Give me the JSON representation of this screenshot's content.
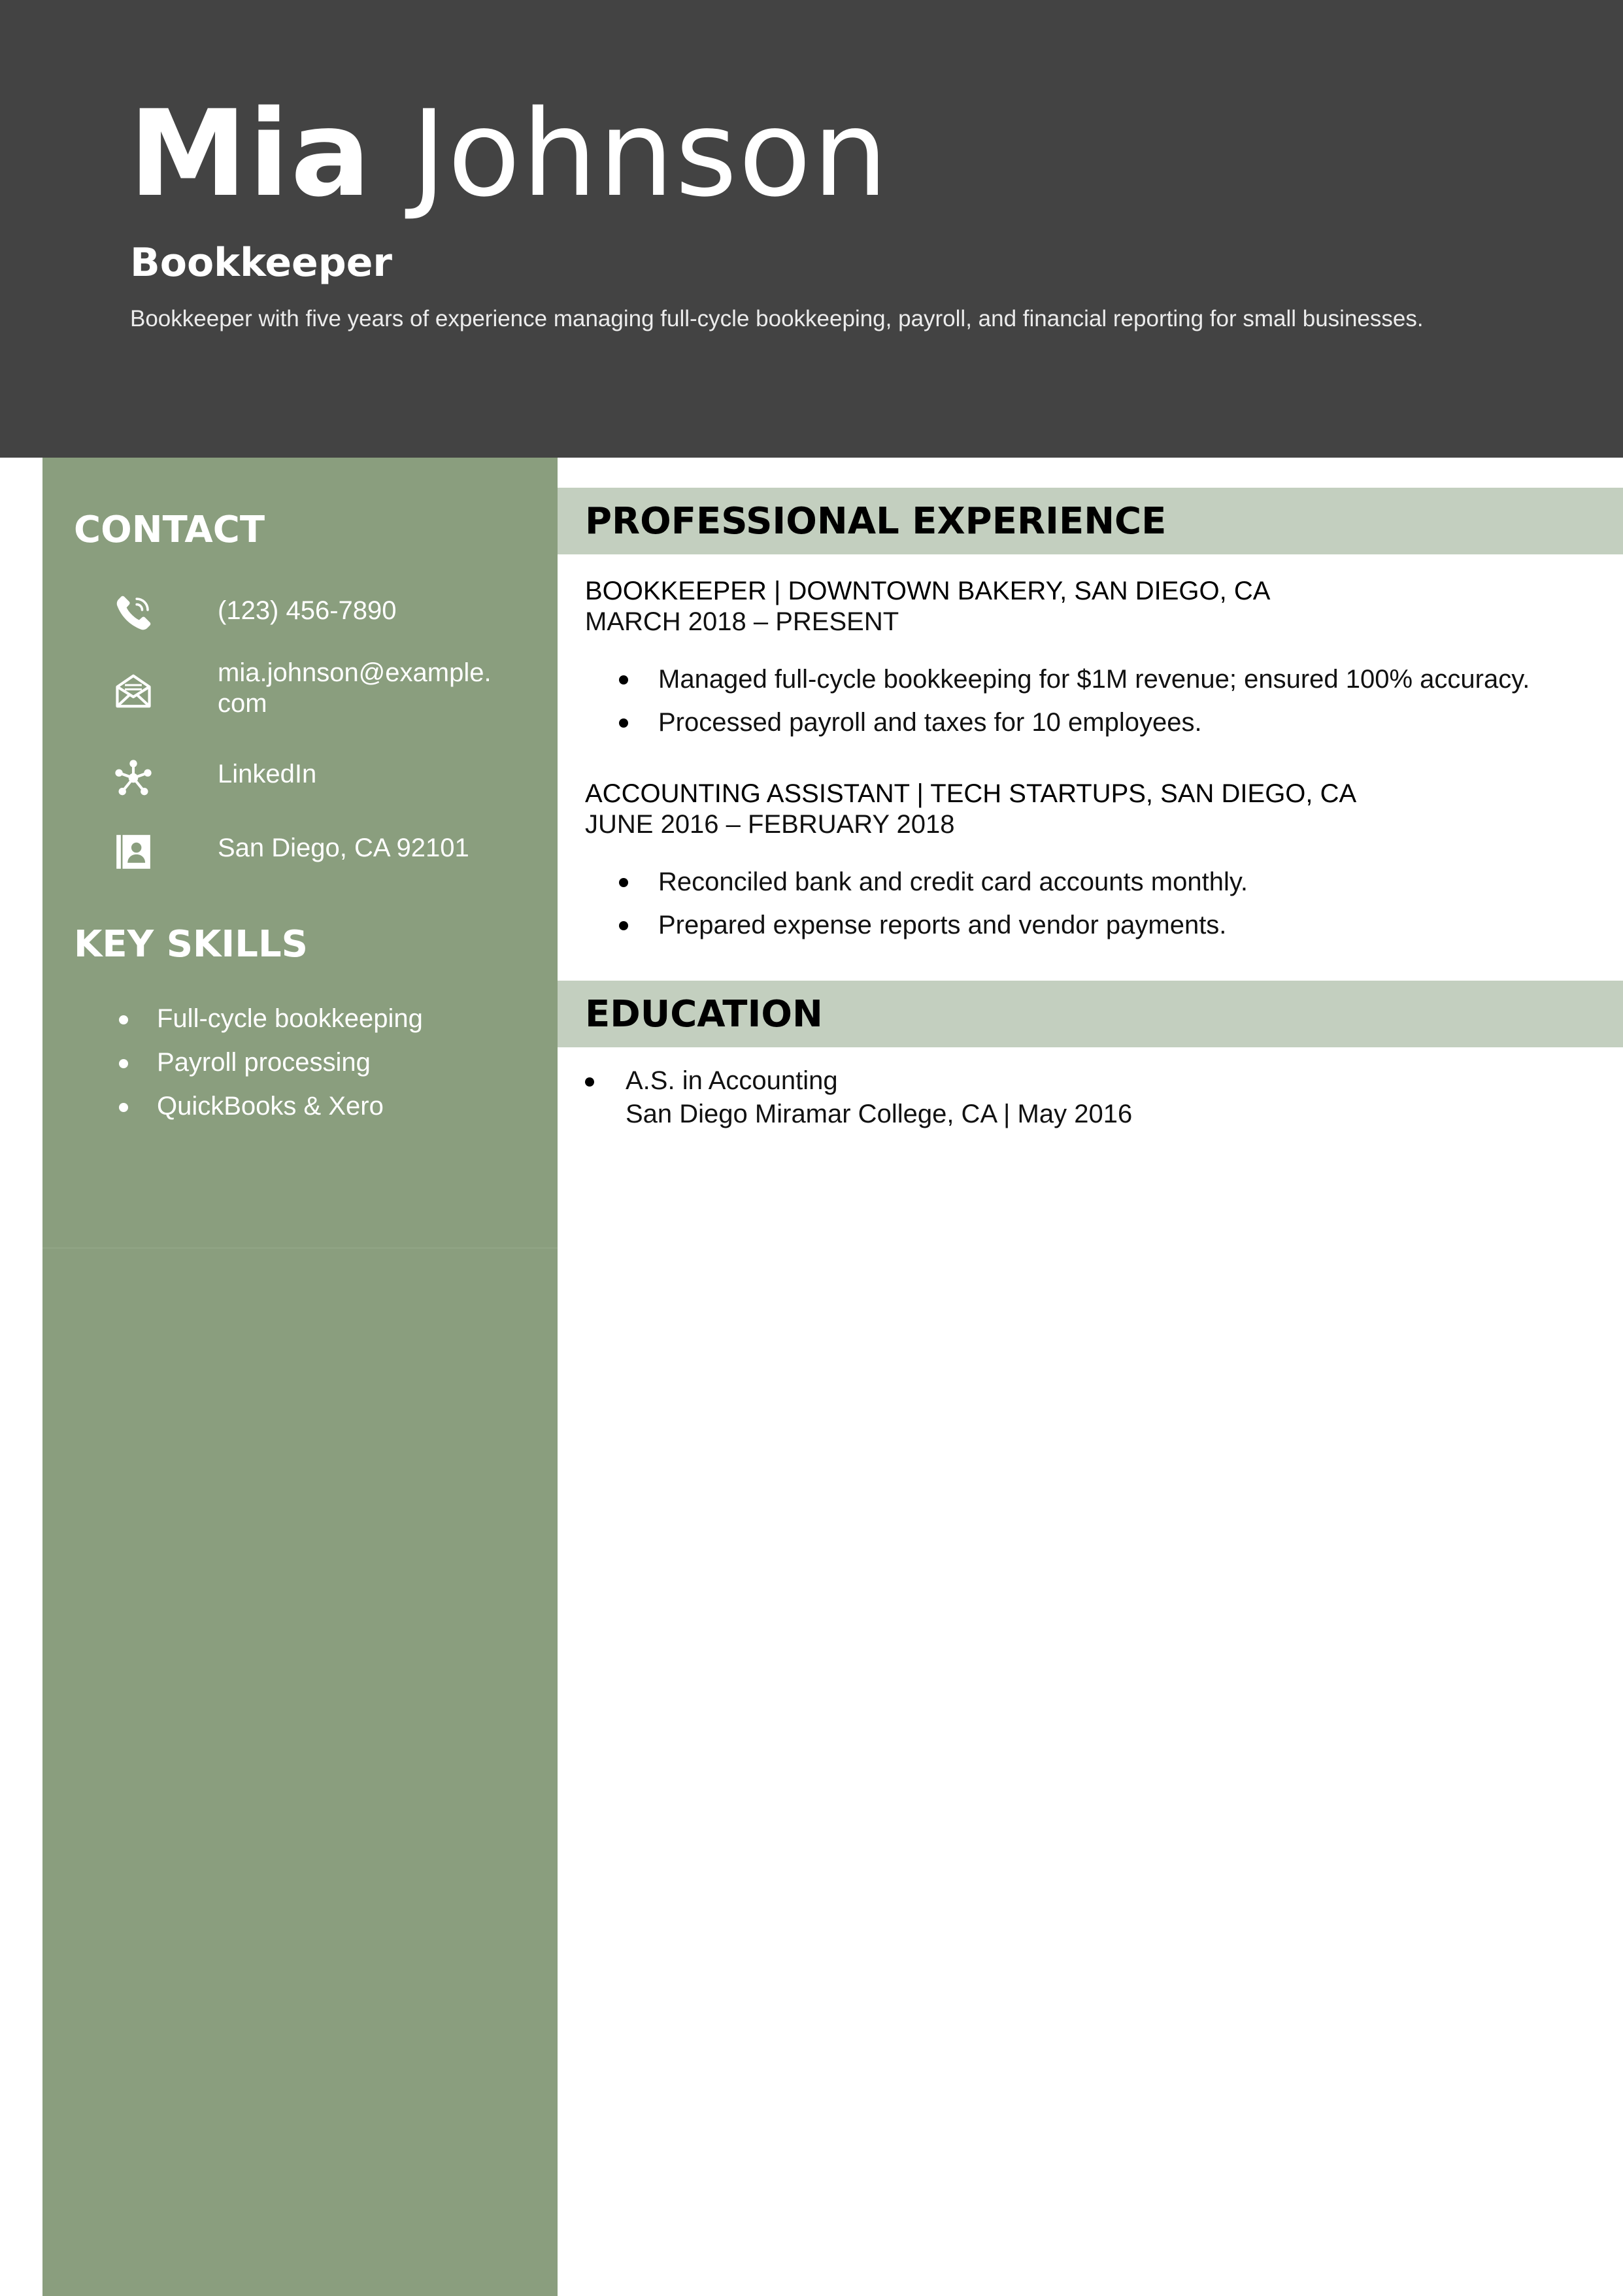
{
  "header": {
    "first_name": "Mia",
    "last_name": "Johnson",
    "title": "Bookkeeper",
    "summary": "Bookkeeper with five years of experience managing full-cycle bookkeeping, payroll, and financial reporting for small businesses."
  },
  "sidebar": {
    "contact_heading": "CONTACT",
    "contact": [
      {
        "icon": "phone-icon",
        "text": "(123) 456-7890"
      },
      {
        "icon": "email-icon",
        "text": "mia.johnson@example.\ncom"
      },
      {
        "icon": "network-icon",
        "text": "LinkedIn"
      },
      {
        "icon": "address-book-icon",
        "text": "San Diego, CA 92101"
      }
    ],
    "skills_heading": "KEY SKILLS",
    "skills": [
      "Full-cycle bookkeeping",
      "Payroll processing",
      "QuickBooks & Xero"
    ]
  },
  "experience": {
    "heading": "PROFESSIONAL EXPERIENCE",
    "jobs": [
      {
        "title": "BOOKKEEPER | DOWNTOWN BAKERY, SAN DIEGO, CA",
        "dates": "MARCH 2018 – PRESENT",
        "bullets": [
          "Managed full-cycle bookkeeping for $1M revenue; ensured 100% accuracy.",
          "Processed payroll and taxes for 10 employees."
        ]
      },
      {
        "title": "ACCOUNTING ASSISTANT | TECH STARTUPS, SAN DIEGO, CA",
        "dates": "JUNE 2016 – FEBRUARY 2018",
        "bullets": [
          "Reconciled bank and credit card accounts monthly.",
          "Prepared expense reports and vendor payments."
        ]
      }
    ]
  },
  "education": {
    "heading": "EDUCATION",
    "degree": "A.S. in Accounting",
    "school": "San Diego Miramar College, CA | May 2016"
  },
  "colors": {
    "header_bg": "#434343",
    "sidebar_bg": "#8a9e7e",
    "section_bar_bg": "#c3cfbf"
  }
}
